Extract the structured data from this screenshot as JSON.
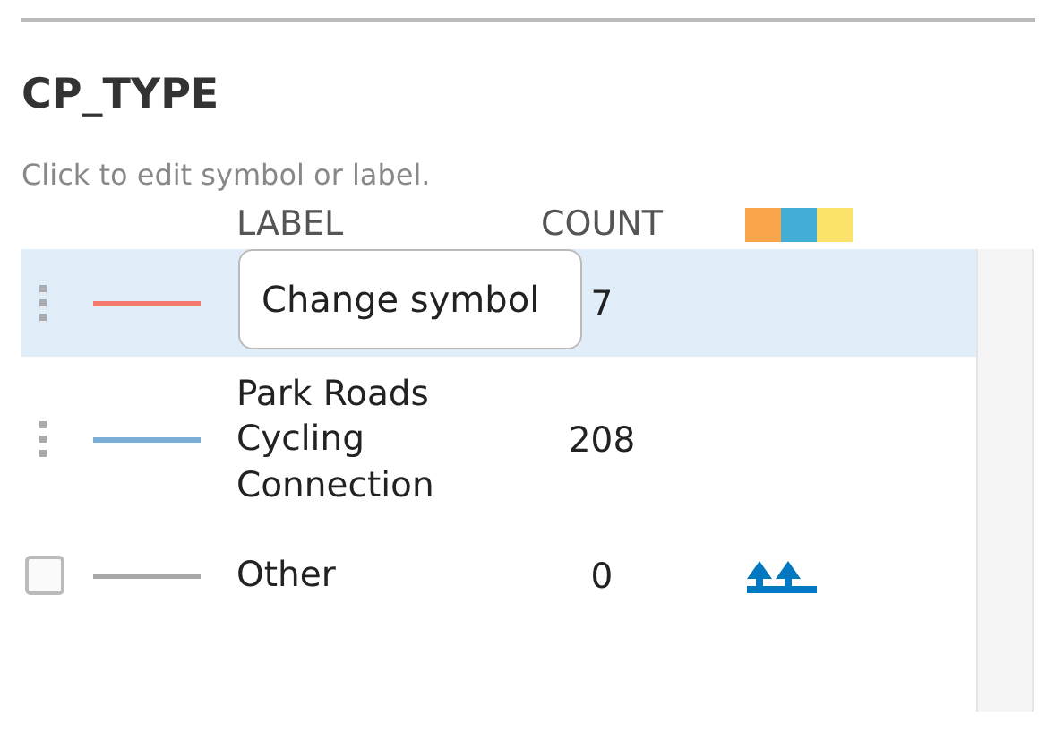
{
  "title": "CP_TYPE",
  "hint": "Click to edit symbol or label.",
  "columns": [
    "LABEL",
    "COUNT"
  ],
  "ramp": [
    {
      "color": "#f9a54b"
    },
    {
      "color": "#43aed5"
    },
    {
      "color": "#fbe36b"
    }
  ],
  "rows": [
    {
      "kind": "draggable",
      "selected": true,
      "color": "#f4786b",
      "count": "7",
      "tooltip": "Change symbol"
    },
    {
      "kind": "draggable",
      "selected": false,
      "color": "#7aaed6",
      "label": "Park Roads Cycling Connection",
      "count": "208"
    },
    {
      "kind": "checkbox",
      "selected": false,
      "checked": false,
      "color": "#a8a8a8",
      "label": "Other",
      "count": "0"
    }
  ]
}
